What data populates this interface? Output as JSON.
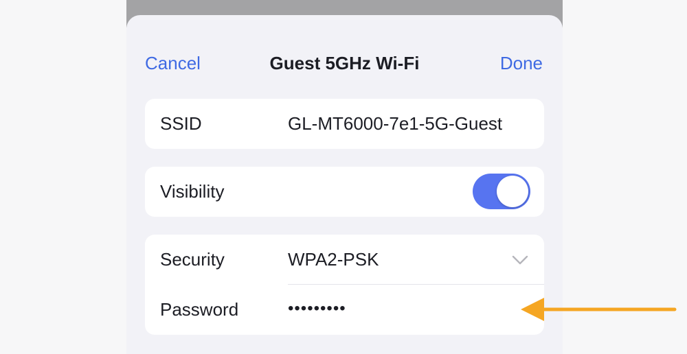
{
  "nav": {
    "cancel_label": "Cancel",
    "title": "Guest 5GHz Wi-Fi",
    "done_label": "Done"
  },
  "ssid": {
    "label": "SSID",
    "value": "GL-MT6000-7e1-5G-Guest"
  },
  "visibility": {
    "label": "Visibility",
    "enabled": true
  },
  "security": {
    "label": "Security",
    "value": "WPA2-PSK",
    "icon": "chevron-down-icon"
  },
  "password": {
    "label": "Password",
    "value": "•••••••••"
  },
  "annotation": {
    "icon": "arrow-left-icon",
    "color": "#f5a623"
  },
  "colors": {
    "accent": "#3f6ae3",
    "toggle_on": "#5774f0"
  }
}
